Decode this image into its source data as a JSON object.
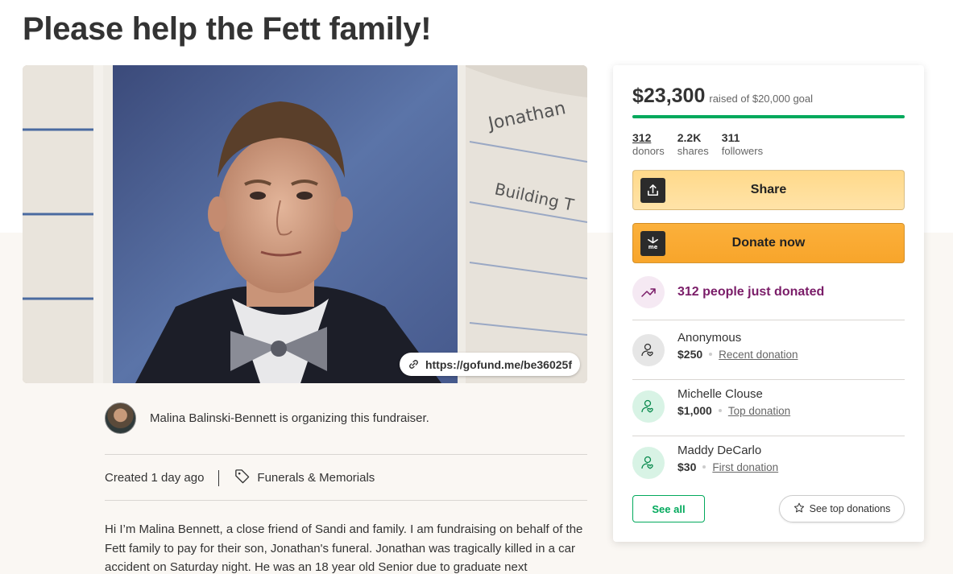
{
  "page": {
    "title": "Please help the Fett family!"
  },
  "hero": {
    "link_url": "https://gofund.me/be36025f",
    "notebook_words": [
      "Jonathan",
      "Building T"
    ]
  },
  "organizer": {
    "text": "Malina Balinski-Bennett is organizing this fundraiser."
  },
  "meta": {
    "created": "Created 1 day ago",
    "category": "Funerals & Memorials"
  },
  "story": {
    "text": "Hi I’m Malina Bennett, a close friend of Sandi and family.  I am fundraising on behalf of the Fett family to pay for their son, Jonathan's funeral. Jonathan was tragically killed in a car accident on Saturday night. He was an 18 year old Senior due to graduate next"
  },
  "card": {
    "raised": "$23,300",
    "goal_text": "raised of $20,000 goal",
    "progress": 1.0,
    "stats": [
      {
        "num": "312",
        "label": "donors"
      },
      {
        "num": "2.2K",
        "label": "shares"
      },
      {
        "num": "311",
        "label": "followers"
      }
    ],
    "share_label": "Share",
    "donate_label": "Donate now",
    "trend_text": "312 people just donated",
    "donations": [
      {
        "name": "Anonymous",
        "amount": "$250",
        "type": "Recent donation"
      },
      {
        "name": "Michelle Clouse",
        "amount": "$1,000",
        "type": "Top donation"
      },
      {
        "name": "Maddy DeCarlo",
        "amount": "$30",
        "type": "First donation"
      }
    ],
    "see_all_label": "See all",
    "see_top_label": "See top donations"
  },
  "colors": {
    "accent_green": "#02a95c",
    "trend_purple": "#7a1c68",
    "share_yellow": "#ffd98a",
    "donate_orange": "#fbb03b"
  },
  "icons": {
    "link": "link-icon",
    "tag": "tag-icon",
    "share": "share-upload-icon",
    "donate": "gofundme-logo-icon",
    "trend": "trending-up-icon",
    "donor": "donor-heart-icon",
    "star": "star-icon"
  }
}
